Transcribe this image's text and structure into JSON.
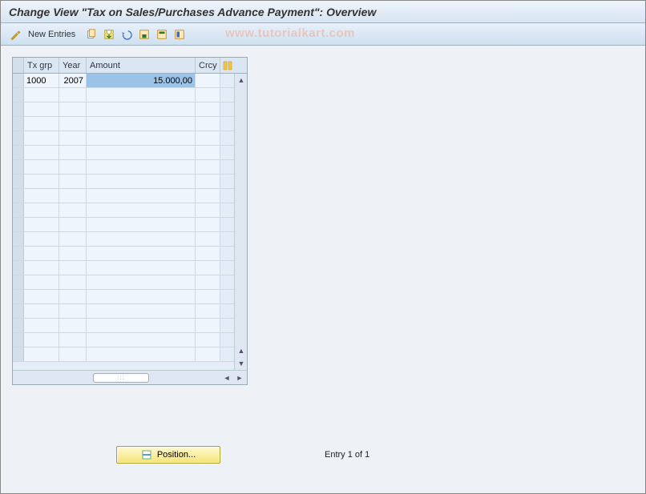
{
  "title": "Change View \"Tax on Sales/Purchases Advance Payment\": Overview",
  "toolbar": {
    "new_entries_label": "New Entries",
    "icons": {
      "wand": "wand-icon",
      "copy": "copy-icon",
      "saveexit": "saveexit-icon",
      "undo": "undo-icon",
      "save": "save-icon",
      "deselect": "deselect-icon",
      "selectall": "selectall-icon"
    }
  },
  "watermark": "www.tutorialkart.com",
  "grid": {
    "columns": {
      "txgrp": "Tx grp",
      "year": "Year",
      "amount": "Amount",
      "crcy": "Crcy"
    },
    "rows": [
      {
        "txgrp": "1000",
        "year": "2007",
        "amount": "15.000,00",
        "crcy": "",
        "amount_selected": true
      }
    ],
    "empty_rows": 19
  },
  "footer": {
    "position_label": "Position...",
    "entry_status": "Entry 1 of 1"
  }
}
